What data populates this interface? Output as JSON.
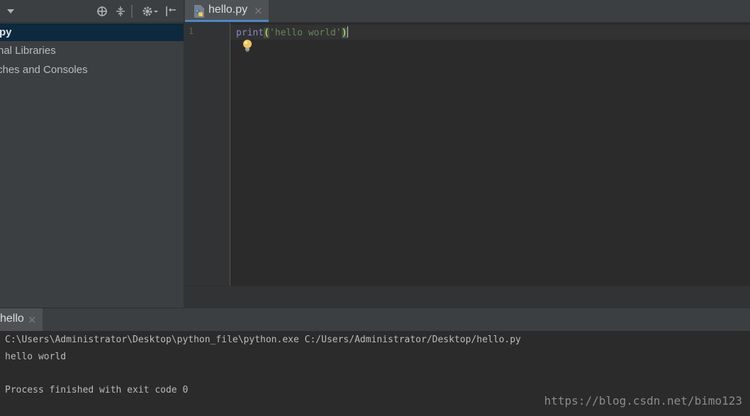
{
  "project": {
    "toolbar_icons": [
      "dropdown-arrow-icon",
      "crosshair-icon",
      "collapse-icon",
      "gear-icon",
      "hide-panel-icon"
    ],
    "tree": [
      {
        "label": "py",
        "selected": true
      },
      {
        "label": "nal Libraries",
        "selected": false
      },
      {
        "label": "ches and Consoles",
        "selected": false
      }
    ]
  },
  "editor": {
    "tab_label": "hello.py",
    "tab_close": "×",
    "line_number": "1",
    "code": {
      "func": "print",
      "open_paren": "(",
      "string": "'hello world'",
      "close_paren": ")"
    }
  },
  "run": {
    "tab_label": "hello",
    "tab_close": "×",
    "console_lines": [
      "C:\\Users\\Administrator\\Desktop\\python_file\\python.exe C:/Users/Administrator/Desktop/hello.py",
      "hello world",
      "",
      "Process finished with exit code 0"
    ]
  },
  "watermark": "https://blog.csdn.net/bimo123",
  "colors": {
    "accent": "#4a88c7",
    "selection": "#0d293e",
    "keyword": "#8888c6",
    "string": "#6a8759"
  }
}
